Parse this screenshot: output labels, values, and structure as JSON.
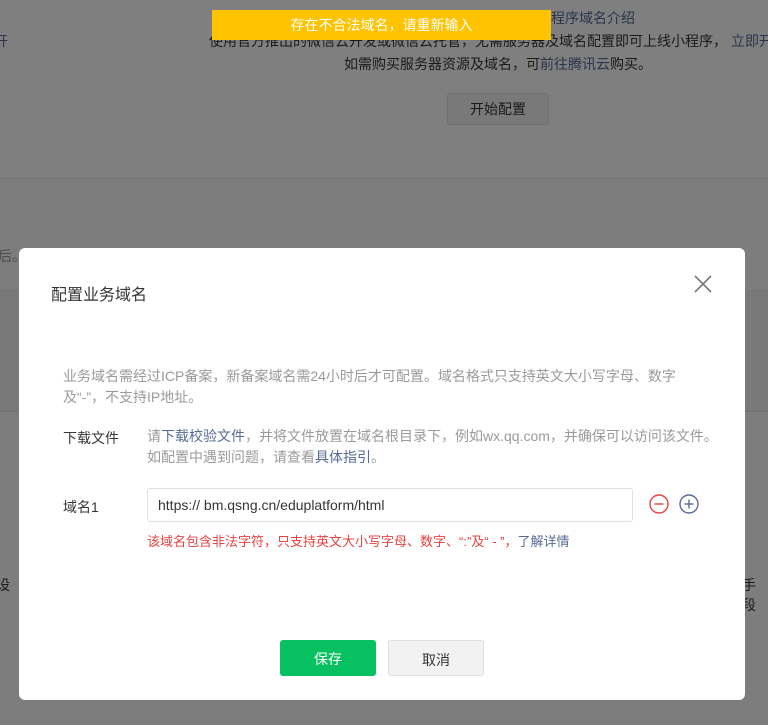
{
  "background": {
    "top_link": "程序域名介绍",
    "line1_left_fragment": "开",
    "line1_text": "使用官方推出的微信云开发或微信云托管，无需服务器及域名配置即可上线小程序，",
    "line1_right_link": "立即开",
    "line2_prefix": "如需购买服务器资源及域名，可",
    "line2_link": "前往腾讯云",
    "line2_suffix": "购买。",
    "start_button": "开始配置",
    "left_fragment": "后。",
    "left_fragment2": "设",
    "right_fragment2": "手段"
  },
  "toast": {
    "message": "存在不合法域名，请重新输入"
  },
  "dialog": {
    "title": "配置业务域名",
    "hint": "业务域名需经过ICP备案，新备案域名需24小时后才可配置。域名格式只支持英文大小写字母、数字及“-”，不支持IP地址。",
    "download_label": "下载文件",
    "download_prefix": "请",
    "download_link": "下载校验文件",
    "download_middle": "，并将文件放置在域名根目录下，例如wx.qq.com，并确保可以访问该文件。如配置中遇到问题，请查看",
    "guide_link": "具体指引",
    "download_suffix": "。",
    "domain_label": "域名1",
    "domain_value": "https:// bm.qsng.cn/eduplatform/html",
    "error_text": "该域名包含非法字符，只支持英文大小写字母、数字、“:”及“ - ”，",
    "error_link": "了解详情",
    "save_button": "保存",
    "cancel_button": "取消"
  },
  "colors": {
    "toast": "#ffc300",
    "primary": "#07c160",
    "error": "#e64340",
    "link": "#576b95",
    "plus_icon": "#576b95",
    "minus_icon": "#e64340"
  },
  "icons": [
    "close-icon",
    "minus-circle-icon",
    "plus-circle-icon"
  ]
}
